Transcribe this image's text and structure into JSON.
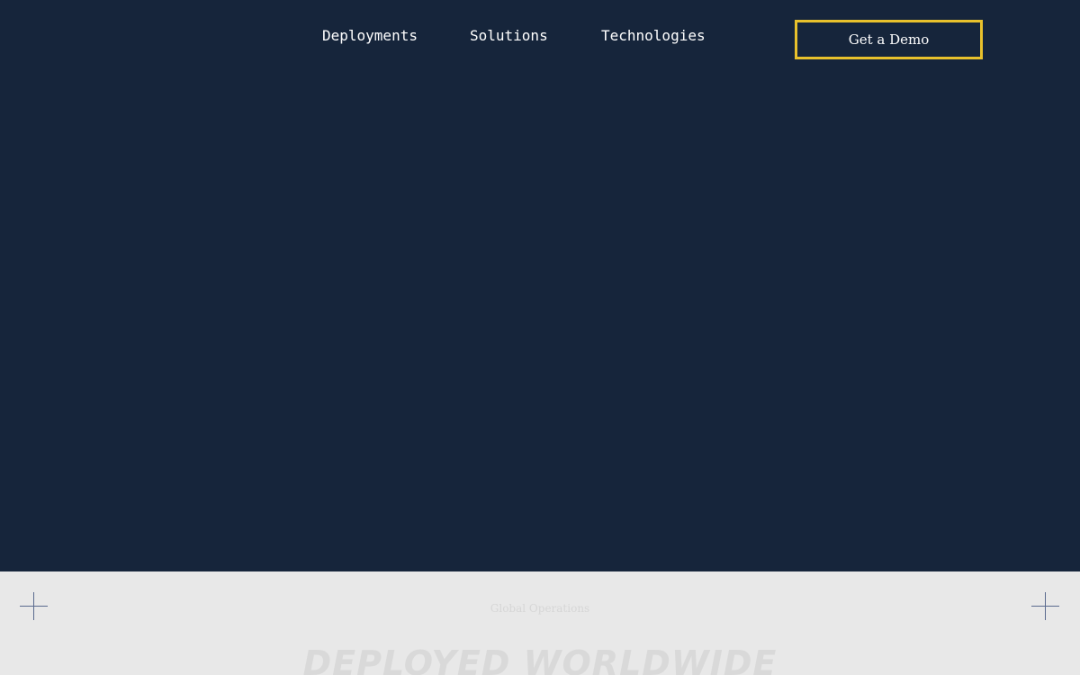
{
  "nav": {
    "links": [
      "Deployments",
      "Solutions",
      "Technologies"
    ],
    "cta_label": "Get a Demo"
  },
  "section": {
    "eyebrow": "Global Operations",
    "title": "DEPLOYED WORLDWIDE"
  },
  "colors": {
    "hero_bg": "#16253b",
    "accent": "#e8c12c",
    "lower_bg": "#e8e8e8"
  },
  "icons": [
    "plus-icon",
    "plus-icon"
  ]
}
